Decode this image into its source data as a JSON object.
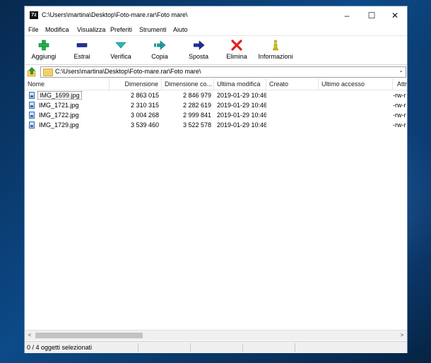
{
  "window": {
    "app_icon": "7z",
    "title": "C:\\Users\\martina\\Desktop\\Foto-mare.rar\\Foto mare\\",
    "controls": {
      "minimize": "–",
      "maximize": "☐",
      "close": "✕"
    }
  },
  "menu": [
    {
      "label": "File"
    },
    {
      "label": "Modifica"
    },
    {
      "label": "Visualizza"
    },
    {
      "label": "Preferiti"
    },
    {
      "label": "Strumenti"
    },
    {
      "label": "Aiuto"
    }
  ],
  "toolbar": [
    {
      "label": "Aggiungi",
      "icon": "plus-icon",
      "color": "#22b14c"
    },
    {
      "label": "Estrai",
      "icon": "minus-icon",
      "color": "#1f2f9a"
    },
    {
      "label": "Verifica",
      "icon": "check-arrow-icon",
      "color": "#27b6b6"
    },
    {
      "label": "Copia",
      "icon": "copy-arrow-icon",
      "color": "#1f9e9e"
    },
    {
      "label": "Sposta",
      "icon": "move-arrow-icon",
      "color": "#1f2f9a"
    },
    {
      "label": "Elimina",
      "icon": "delete-x-icon",
      "color": "#e02020"
    },
    {
      "label": "Informazioni",
      "icon": "info-icon",
      "color": "#d4c400"
    }
  ],
  "path": {
    "value": "C:\\Users\\martina\\Desktop\\Foto-mare.rar\\Foto mare\\"
  },
  "columns": [
    {
      "label": "Nome"
    },
    {
      "label": "Dimensione"
    },
    {
      "label": "Dimensione co..."
    },
    {
      "label": "Ultima modifica"
    },
    {
      "label": "Creato"
    },
    {
      "label": "Ultimo accesso"
    },
    {
      "label": "Attr"
    }
  ],
  "files": [
    {
      "name": "IMG_1699.jpg",
      "size": "2 863 015",
      "packed": "2 846 979",
      "modified": "2019-01-29 10:46",
      "attr": "-rw-r"
    },
    {
      "name": "IMG_1721.jpg",
      "size": "2 310 315",
      "packed": "2 282 619",
      "modified": "2019-01-29 10:46",
      "attr": "-rw-r"
    },
    {
      "name": "IMG_1722.jpg",
      "size": "3 004 268",
      "packed": "2 999 841",
      "modified": "2019-01-29 10:46",
      "attr": "-rw-r"
    },
    {
      "name": "IMG_1729.jpg",
      "size": "3 539 460",
      "packed": "3 522 578",
      "modified": "2019-01-29 10:46",
      "attr": "-rw-r"
    }
  ],
  "scrollbar": {
    "left": "<",
    "right": ">"
  },
  "status": {
    "text": "0 / 4 oggetti selezionati"
  }
}
